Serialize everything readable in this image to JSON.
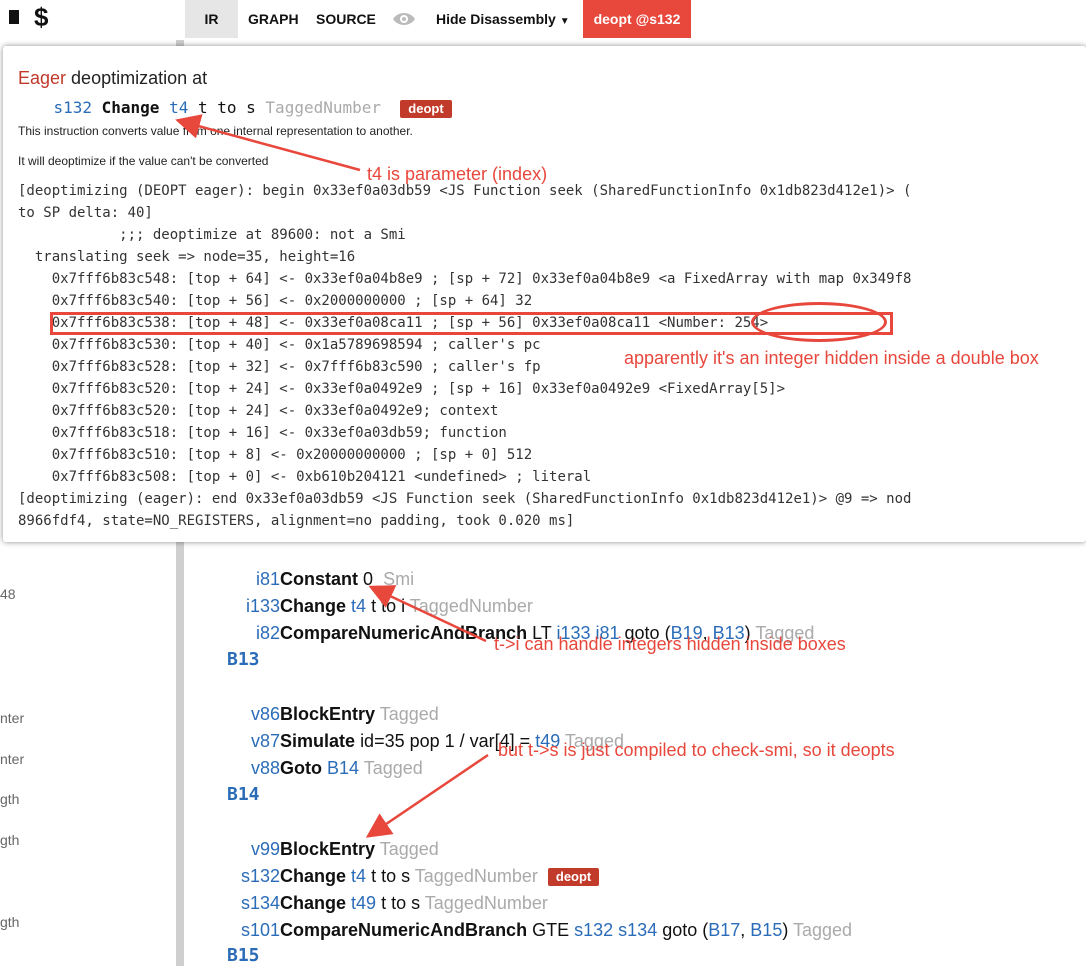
{
  "topbar": {
    "logo_chars": [
      "$"
    ],
    "tabs": [
      {
        "label": "IR"
      },
      {
        "label": "GRAPH"
      },
      {
        "label": "SOURCE"
      }
    ],
    "eye_icon": "eye-icon",
    "hide_label": "Hide Disassembly",
    "deopt_label": "deopt @s132",
    "colors": {
      "deopt": "#e8473c",
      "tab_active": "#e6e6e6"
    }
  },
  "sidebar": {
    "fragments": [
      "48",
      "nter",
      "nter",
      "gth",
      "gth",
      "gth"
    ]
  },
  "popup": {
    "title_eager": "Eager",
    "title_rest": " deoptimization at",
    "instr": {
      "id": "s132",
      "op": "Change",
      "ref": "t4",
      "text": "t to s",
      "type": "TaggedNumber",
      "badge": "deopt"
    },
    "desc1": "This instruction converts value from one internal representation to another.",
    "desc2": "It will deoptimize if the value can't be converted",
    "log": [
      "[deoptimizing (DEOPT eager): begin 0x33ef0a03db59 <JS Function seek (SharedFunctionInfo 0x1db823d412e1)> (",
      "to SP delta: 40]",
      "            ;;; deoptimize at 89600: not a Smi",
      "  translating seek => node=35, height=16",
      "    0x7fff6b83c548: [top + 64] <- 0x33ef0a04b8e9 ; [sp + 72] 0x33ef0a04b8e9 <a FixedArray with map 0x349f8",
      "    0x7fff6b83c540: [top + 56] <- 0x2000000000 ; [sp + 64] 32",
      "    0x7fff6b83c538: [top + 48] <- 0x33ef0a08ca11 ; [sp + 56] 0x33ef0a08ca11 <Number: 254>",
      "    0x7fff6b83c530: [top + 40] <- 0x1a5789698594 ; caller's pc",
      "    0x7fff6b83c528: [top + 32] <- 0x7fff6b83c590 ; caller's fp",
      "    0x7fff6b83c520: [top + 24] <- 0x33ef0a0492e9 ; [sp + 16] 0x33ef0a0492e9 <FixedArray[5]>",
      "    0x7fff6b83c520: [top + 24] <- 0x33ef0a0492e9; context",
      "    0x7fff6b83c518: [top + 16] <- 0x33ef0a03db59; function",
      "    0x7fff6b83c510: [top + 8] <- 0x20000000000 ; [sp + 0] 512",
      "    0x7fff6b83c508: [top + 0] <- 0xb610b204121 <undefined> ; literal",
      "[deoptimizing (eager): end 0x33ef0a03db59 <JS Function seek (SharedFunctionInfo 0x1db823d412e1)> @9 => nod",
      "8966fdf4, state=NO_REGISTERS, alignment=no padding, took 0.020 ms]"
    ]
  },
  "ir": {
    "lines": [
      {
        "id": "i81",
        "op": "Constant",
        "ref": "",
        "text": "0",
        "type": "Smi",
        "badge": ""
      },
      {
        "id": "i133",
        "op": "Change",
        "ref": "t4",
        "text": "t to i",
        "type": "TaggedNumber",
        "badge": ""
      },
      {
        "id": "i82",
        "op": "CompareNumericAndBranch",
        "ref": "",
        "text": "LT i133 i81 goto (B19, B13)",
        "type": "Tagged",
        "badge": ""
      },
      {
        "id": "v86",
        "op": "BlockEntry",
        "ref": "",
        "text": "",
        "type": "Tagged",
        "badge": ""
      },
      {
        "id": "v87",
        "op": "Simulate",
        "ref": "",
        "text": "id=35 pop 1 / var[4] = t49",
        "type": "Tagged",
        "badge": ""
      },
      {
        "id": "v88",
        "op": "Goto",
        "ref": "",
        "text": "B14",
        "type": "Tagged",
        "badge": ""
      },
      {
        "id": "v99",
        "op": "BlockEntry",
        "ref": "",
        "text": "",
        "type": "Tagged",
        "badge": ""
      },
      {
        "id": "s132",
        "op": "Change",
        "ref": "t4",
        "text": "t to s",
        "type": "TaggedNumber",
        "badge": "deopt"
      },
      {
        "id": "s134",
        "op": "Change",
        "ref": "t49",
        "text": "t to s",
        "type": "TaggedNumber",
        "badge": ""
      },
      {
        "id": "s101",
        "op": "CompareNumericAndBranch",
        "ref": "",
        "text": "GTE s132 s134 goto (B17, B15)",
        "type": "Tagged",
        "badge": ""
      }
    ],
    "blocks": [
      "B13",
      "B14",
      "B15"
    ]
  },
  "annotations": {
    "a1": "t4 is parameter (index)",
    "a2": "apparently it's an integer hidden inside a double box",
    "a3": "t->i can handle integers hidden inside boxes",
    "a4": "but t->s is just compiled to check-smi, so it deopts",
    "color": "#e8473c"
  }
}
